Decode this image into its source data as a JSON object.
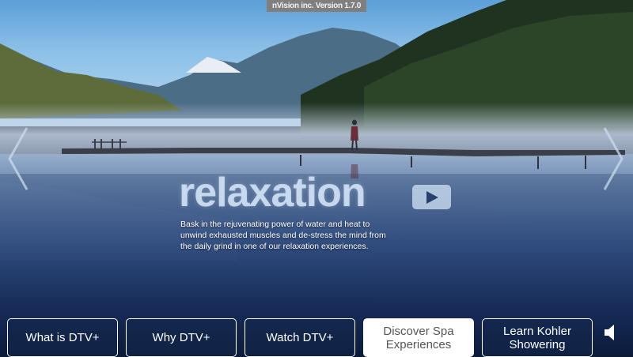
{
  "app": {
    "version_label": "nVision inc. Version 1.7.0"
  },
  "hero": {
    "title": "relaxation",
    "description": "Bask in the rejuvenating power of water and heat to unwind exhausted muscles and de-stress the mind from the daily grind in one of our relaxation experiences.",
    "play_icon": "play-icon"
  },
  "carousel": {
    "prev_icon": "chevron-left-icon",
    "next_icon": "chevron-right-icon"
  },
  "nav": {
    "items": [
      {
        "line1": "What is DTV+",
        "line2": "",
        "active": false
      },
      {
        "line1": "Why DTV+",
        "line2": "",
        "active": false
      },
      {
        "line1": "Watch DTV+",
        "line2": "",
        "active": false
      },
      {
        "line1": "Discover Spa",
        "line2": "Experiences",
        "active": true
      },
      {
        "line1": "Learn Kohler",
        "line2": "Showering",
        "active": false
      }
    ]
  },
  "audio": {
    "icon": "speaker-icon"
  },
  "colors": {
    "accent_text": "#d6e8fa",
    "active_button_bg": "#ffffff",
    "version_badge_bg": "#7f7f7f"
  }
}
